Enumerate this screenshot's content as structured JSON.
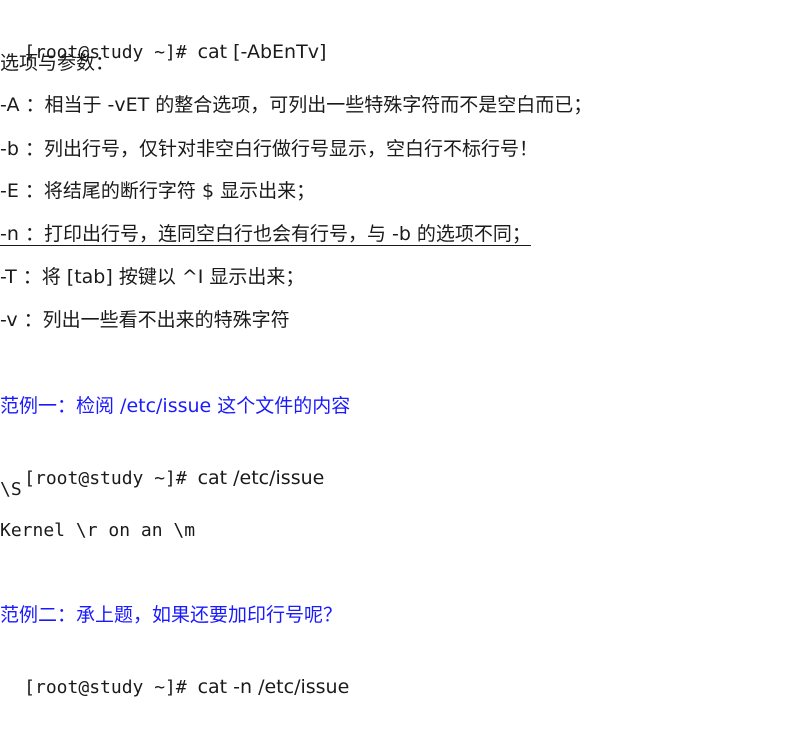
{
  "lines": {
    "cmd_syntax_prompt": "[root@study ~]# ",
    "cmd_syntax_rest": "cat [-AbEnTv]",
    "options_heading": "选项与参数：",
    "opt_A": "-A ：相当于 -vET 的整合选项，可列出一些特殊字符而不是空白而已；",
    "opt_b": "-b ：列出行号，仅针对非空白行做行号显示，空白行不标行号！",
    "opt_E": "-E ：将结尾的断行字符 $ 显示出来；",
    "opt_n": "-n ：打印出行号，连同空白行也会有行号，与 -b 的选项不同；",
    "opt_T": "-T ：将 [tab] 按键以 ^I 显示出来；",
    "opt_v": "-v ：列出一些看不出来的特殊字符",
    "example1_title": "范例一：检阅 /etc/issue 这个文件的内容",
    "example1_prompt": "[root@study ~]# ",
    "example1_cmd": "cat /etc/issue",
    "example1_out1": "\\S",
    "example1_out2": "Kernel \\r on an \\m",
    "example2_title": "范例二：承上题，如果还要加印行号呢？",
    "example2_prompt": "[root@study ~]# ",
    "example2_cmd": "cat -n /etc/issue"
  },
  "colors": {
    "text": "#1a1a1a",
    "example_title": "#1a1aff",
    "background": "#ffffff"
  }
}
